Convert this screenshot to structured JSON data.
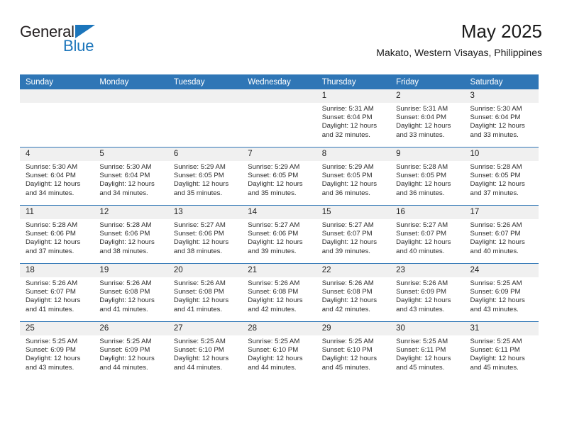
{
  "brand": {
    "name_part1": "General",
    "name_part2": "Blue",
    "triangle_color": "#1b75bb",
    "text_color": "#231f20"
  },
  "header": {
    "title": "May 2025",
    "subtitle": "Makato, Western Visayas, Philippines"
  },
  "theme": {
    "accent": "#2f76b6",
    "header_text": "#ffffff",
    "daynum_band": "#f0f0f0",
    "body_text": "#2b2b2b"
  },
  "calendar": {
    "weekday_headers": [
      "Sunday",
      "Monday",
      "Tuesday",
      "Wednesday",
      "Thursday",
      "Friday",
      "Saturday"
    ],
    "weeks": [
      [
        {
          "day": "",
          "info": ""
        },
        {
          "day": "",
          "info": ""
        },
        {
          "day": "",
          "info": ""
        },
        {
          "day": "",
          "info": ""
        },
        {
          "day": "1",
          "info": "Sunrise: 5:31 AM\nSunset: 6:04 PM\nDaylight: 12 hours\nand 32 minutes."
        },
        {
          "day": "2",
          "info": "Sunrise: 5:31 AM\nSunset: 6:04 PM\nDaylight: 12 hours\nand 33 minutes."
        },
        {
          "day": "3",
          "info": "Sunrise: 5:30 AM\nSunset: 6:04 PM\nDaylight: 12 hours\nand 33 minutes."
        }
      ],
      [
        {
          "day": "4",
          "info": "Sunrise: 5:30 AM\nSunset: 6:04 PM\nDaylight: 12 hours\nand 34 minutes."
        },
        {
          "day": "5",
          "info": "Sunrise: 5:30 AM\nSunset: 6:04 PM\nDaylight: 12 hours\nand 34 minutes."
        },
        {
          "day": "6",
          "info": "Sunrise: 5:29 AM\nSunset: 6:05 PM\nDaylight: 12 hours\nand 35 minutes."
        },
        {
          "day": "7",
          "info": "Sunrise: 5:29 AM\nSunset: 6:05 PM\nDaylight: 12 hours\nand 35 minutes."
        },
        {
          "day": "8",
          "info": "Sunrise: 5:29 AM\nSunset: 6:05 PM\nDaylight: 12 hours\nand 36 minutes."
        },
        {
          "day": "9",
          "info": "Sunrise: 5:28 AM\nSunset: 6:05 PM\nDaylight: 12 hours\nand 36 minutes."
        },
        {
          "day": "10",
          "info": "Sunrise: 5:28 AM\nSunset: 6:05 PM\nDaylight: 12 hours\nand 37 minutes."
        }
      ],
      [
        {
          "day": "11",
          "info": "Sunrise: 5:28 AM\nSunset: 6:06 PM\nDaylight: 12 hours\nand 37 minutes."
        },
        {
          "day": "12",
          "info": "Sunrise: 5:28 AM\nSunset: 6:06 PM\nDaylight: 12 hours\nand 38 minutes."
        },
        {
          "day": "13",
          "info": "Sunrise: 5:27 AM\nSunset: 6:06 PM\nDaylight: 12 hours\nand 38 minutes."
        },
        {
          "day": "14",
          "info": "Sunrise: 5:27 AM\nSunset: 6:06 PM\nDaylight: 12 hours\nand 39 minutes."
        },
        {
          "day": "15",
          "info": "Sunrise: 5:27 AM\nSunset: 6:07 PM\nDaylight: 12 hours\nand 39 minutes."
        },
        {
          "day": "16",
          "info": "Sunrise: 5:27 AM\nSunset: 6:07 PM\nDaylight: 12 hours\nand 40 minutes."
        },
        {
          "day": "17",
          "info": "Sunrise: 5:26 AM\nSunset: 6:07 PM\nDaylight: 12 hours\nand 40 minutes."
        }
      ],
      [
        {
          "day": "18",
          "info": "Sunrise: 5:26 AM\nSunset: 6:07 PM\nDaylight: 12 hours\nand 41 minutes."
        },
        {
          "day": "19",
          "info": "Sunrise: 5:26 AM\nSunset: 6:08 PM\nDaylight: 12 hours\nand 41 minutes."
        },
        {
          "day": "20",
          "info": "Sunrise: 5:26 AM\nSunset: 6:08 PM\nDaylight: 12 hours\nand 41 minutes."
        },
        {
          "day": "21",
          "info": "Sunrise: 5:26 AM\nSunset: 6:08 PM\nDaylight: 12 hours\nand 42 minutes."
        },
        {
          "day": "22",
          "info": "Sunrise: 5:26 AM\nSunset: 6:08 PM\nDaylight: 12 hours\nand 42 minutes."
        },
        {
          "day": "23",
          "info": "Sunrise: 5:26 AM\nSunset: 6:09 PM\nDaylight: 12 hours\nand 43 minutes."
        },
        {
          "day": "24",
          "info": "Sunrise: 5:25 AM\nSunset: 6:09 PM\nDaylight: 12 hours\nand 43 minutes."
        }
      ],
      [
        {
          "day": "25",
          "info": "Sunrise: 5:25 AM\nSunset: 6:09 PM\nDaylight: 12 hours\nand 43 minutes."
        },
        {
          "day": "26",
          "info": "Sunrise: 5:25 AM\nSunset: 6:09 PM\nDaylight: 12 hours\nand 44 minutes."
        },
        {
          "day": "27",
          "info": "Sunrise: 5:25 AM\nSunset: 6:10 PM\nDaylight: 12 hours\nand 44 minutes."
        },
        {
          "day": "28",
          "info": "Sunrise: 5:25 AM\nSunset: 6:10 PM\nDaylight: 12 hours\nand 44 minutes."
        },
        {
          "day": "29",
          "info": "Sunrise: 5:25 AM\nSunset: 6:10 PM\nDaylight: 12 hours\nand 45 minutes."
        },
        {
          "day": "30",
          "info": "Sunrise: 5:25 AM\nSunset: 6:11 PM\nDaylight: 12 hours\nand 45 minutes."
        },
        {
          "day": "31",
          "info": "Sunrise: 5:25 AM\nSunset: 6:11 PM\nDaylight: 12 hours\nand 45 minutes."
        }
      ]
    ]
  }
}
